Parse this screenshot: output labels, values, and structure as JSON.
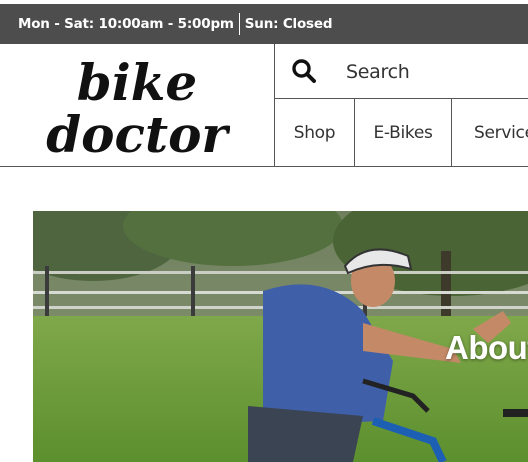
{
  "topbar": {
    "hours": "Mon - Sat: 10:00am - 5:00pm",
    "closed": "Sun: Closed",
    "background": "#4d4d4d"
  },
  "logo": {
    "line1": "bike",
    "line2": "doctor"
  },
  "search": {
    "placeholder": "Search",
    "icon": "search-icon"
  },
  "nav": {
    "items": [
      {
        "label": "Shop"
      },
      {
        "label": "E-Bikes"
      },
      {
        "label": "Services"
      }
    ]
  },
  "hero": {
    "heading": "About",
    "image": "cyclist-high-five-photo"
  }
}
